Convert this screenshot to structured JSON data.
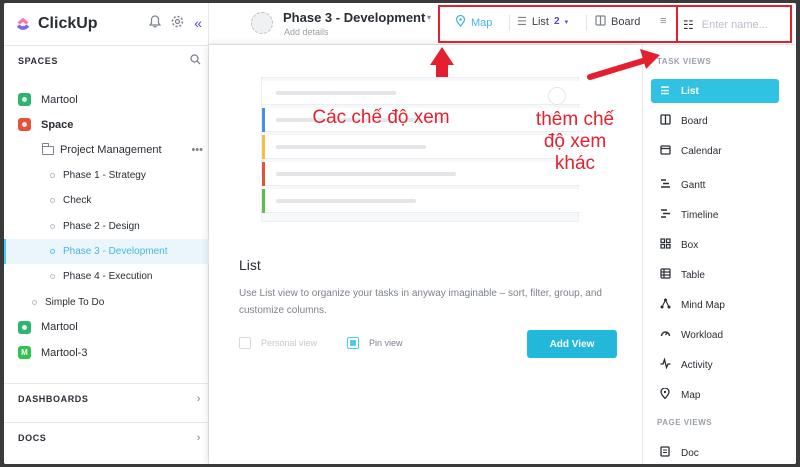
{
  "app": {
    "name": "ClickUp"
  },
  "sidebar": {
    "spaces_label": "SPACES",
    "dashboards_label": "DASHBOARDS",
    "docs_label": "DOCS",
    "tree": [
      {
        "label": "Martool",
        "color": "#2db46e"
      },
      {
        "label": "Space",
        "color": "#e2533a"
      },
      {
        "label": "Project Management"
      },
      {
        "label": "Phase 1 - Strategy"
      },
      {
        "label": "Check"
      },
      {
        "label": "Phase 2 - Design"
      },
      {
        "label": "Phase 3 - Development"
      },
      {
        "label": "Phase 4 - Execution"
      },
      {
        "label": "Simple To Do"
      },
      {
        "label": "Martool",
        "color": "#2db46e"
      },
      {
        "label": "Martool-3",
        "letter": "M",
        "color": "#31c34d"
      }
    ]
  },
  "header": {
    "title": "Phase 3 - Development",
    "subtitle": "Add details",
    "tabs": [
      {
        "label": "Map"
      },
      {
        "label": "List",
        "count": "2"
      },
      {
        "label": "Board"
      }
    ],
    "search_placeholder": "Enter name..."
  },
  "main": {
    "title": "List",
    "description": "Use List view to organize your tasks in anyway imaginable – sort, filter, group, and customize columns.",
    "personal_view": "Personal view",
    "pin_view": "Pin view",
    "add_view": "Add View"
  },
  "right_panel": {
    "task_views_label": "TASK VIEWS",
    "page_views_label": "PAGE VIEWS",
    "items": [
      "List",
      "Board",
      "Calendar",
      "Gantt",
      "Timeline",
      "Box",
      "Table",
      "Mind Map",
      "Workload",
      "Activity",
      "Map"
    ],
    "page_items": [
      "Doc"
    ]
  },
  "annotations": {
    "left_note": "Các chế độ xem",
    "right_note": "thêm chế độ xem khác"
  },
  "colors": {
    "accent": "#49ccf9",
    "annotation": "#e5202e"
  }
}
